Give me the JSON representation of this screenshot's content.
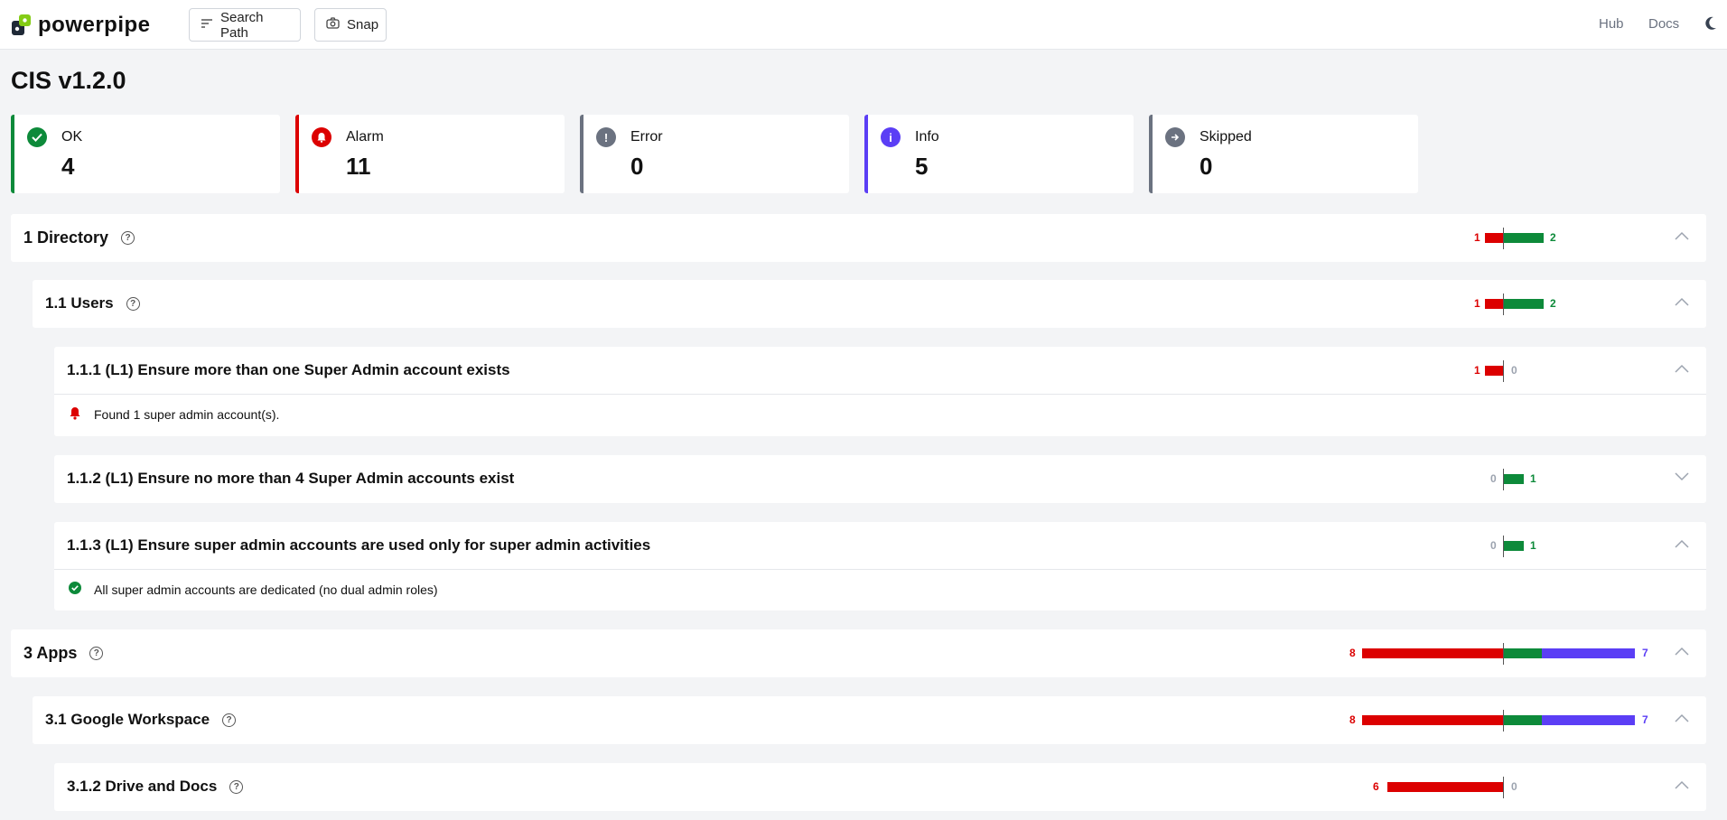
{
  "header": {
    "logo_text": "powerpipe",
    "search_path_label": "Search Path",
    "snap_label": "Snap",
    "hub_label": "Hub",
    "docs_label": "Docs"
  },
  "page": {
    "title": "CIS v1.2.0"
  },
  "summary": [
    {
      "label": "OK",
      "value": "4",
      "color": "#0d8a3a",
      "icon": "check-circle-icon"
    },
    {
      "label": "Alarm",
      "value": "11",
      "color": "#dc0000",
      "icon": "bell-icon"
    },
    {
      "label": "Error",
      "value": "0",
      "color": "#6b7280",
      "icon": "exclamation-circle-icon"
    },
    {
      "label": "Info",
      "value": "5",
      "color": "#5b3ef5",
      "icon": "info-circle-icon"
    },
    {
      "label": "Skipped",
      "value": "0",
      "color": "#6b7280",
      "icon": "arrow-right-circle-icon"
    }
  ],
  "groups": {
    "directory": {
      "title": "1 Directory",
      "alarm": "1",
      "ok": "2"
    },
    "users": {
      "title": "1.1 Users",
      "alarm": "1",
      "ok": "2"
    },
    "c111": {
      "title": "1.1.1 (L1) Ensure more than one Super Admin account exists",
      "alarm": "1",
      "ok": "0",
      "result": "Found 1 super admin account(s)."
    },
    "c112": {
      "title": "1.1.2 (L1) Ensure no more than 4 Super Admin accounts exist",
      "alarm": "0",
      "ok": "1"
    },
    "c113": {
      "title": "1.1.3 (L1) Ensure super admin accounts are used only for super admin activities",
      "alarm": "0",
      "ok": "1",
      "result": "All super admin accounts are dedicated (no dual admin roles)"
    },
    "apps": {
      "title": "3 Apps",
      "alarm": "8",
      "ok": "7"
    },
    "workspace": {
      "title": "3.1 Google Workspace",
      "alarm": "8",
      "ok": "7"
    },
    "drive": {
      "title": "3.1.2 Drive and Docs",
      "alarm": "6",
      "ok": "0"
    }
  },
  "colors": {
    "alarm": "#dc0000",
    "ok": "#0d8a3a",
    "info": "#5b3ef5"
  }
}
